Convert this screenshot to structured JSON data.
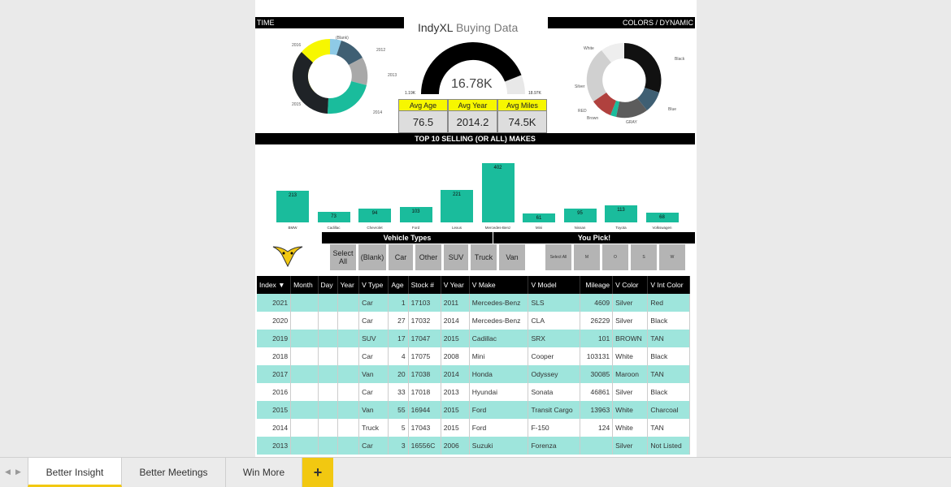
{
  "report": {
    "title_main": "IndyXL",
    "title_sub": "Buying Data",
    "time_header": "TIME",
    "colors_header": "COLORS / DYNAMIC",
    "makes_header": "TOP 10 SELLING (OR ALL) MAKES",
    "vehicle_types_header": "Vehicle Types",
    "you_pick_header": "You Pick!"
  },
  "gauge": {
    "value": "16.78K",
    "min": "1.19K",
    "max": "18.97K",
    "fraction": 0.88
  },
  "kpis": [
    {
      "label": "Avg Age",
      "value": "76.5"
    },
    {
      "label": "Avg Year",
      "value": "2014.2"
    },
    {
      "label": "Avg Miles",
      "value": "74.5K"
    }
  ],
  "time_donut": {
    "labels": [
      "(Blank)",
      "2012",
      "2013",
      "2014",
      "2015",
      "2016"
    ],
    "colors": {
      "blank": "#8ecae6",
      "y2012": "#3f5f73",
      "y2013": "#a9a9a9",
      "y2014": "#1abc9c",
      "y2015": "#1f2327",
      "y2016": "#f7f700"
    }
  },
  "colors_donut": {
    "labels": [
      "Black",
      "Blue",
      "GRAY",
      "Brown",
      "RED",
      "Silver",
      "White"
    ],
    "colors": {
      "black": "#111111",
      "blue": "#3f5f73",
      "gray": "#5c5c5c",
      "brown": "#1abc9c",
      "red": "#b0413e",
      "silver": "#d0d0d0",
      "white": "#eeeeee"
    }
  },
  "chart_data": {
    "type": "bar",
    "title": "TOP 10 SELLING (OR ALL) MAKES",
    "categories": [
      "BMW",
      "Cadillac",
      "Chevrolet",
      "Ford",
      "Lexus",
      "Mercedes-Benz",
      "Mini",
      "Nissan",
      "Toyota",
      "Volkswagen"
    ],
    "values": [
      213,
      73,
      94,
      103,
      221,
      402,
      61,
      95,
      113,
      68
    ],
    "ylim": [
      0,
      402
    ],
    "color": "#1abc9c"
  },
  "vehicle_type_buttons": [
    "Select All",
    "(Blank)",
    "Car",
    "Other",
    "SUV",
    "Truck",
    "Van"
  ],
  "you_pick_buttons": [
    "Select All",
    "M",
    "O",
    "S",
    "W"
  ],
  "table": {
    "columns": [
      "Index",
      "Month",
      "Day",
      "Year",
      "V Type",
      "Age",
      "Stock #",
      "V Year",
      "V Make",
      "V Model",
      "Mileage",
      "V Color",
      "V Int Color"
    ],
    "rows": [
      [
        "2021",
        "",
        "",
        "",
        "Car",
        "1",
        "17103",
        "2011",
        "Mercedes-Benz",
        "SLS",
        "4609",
        "Silver",
        "Red"
      ],
      [
        "2020",
        "",
        "",
        "",
        "Car",
        "27",
        "17032",
        "2014",
        "Mercedes-Benz",
        "CLA",
        "26229",
        "Silver",
        "Black"
      ],
      [
        "2019",
        "",
        "",
        "",
        "SUV",
        "17",
        "17047",
        "2015",
        "Cadillac",
        "SRX",
        "101",
        "BROWN",
        "TAN"
      ],
      [
        "2018",
        "",
        "",
        "",
        "Car",
        "4",
        "17075",
        "2008",
        "Mini",
        "Cooper",
        "103131",
        "White",
        "Black"
      ],
      [
        "2017",
        "",
        "",
        "",
        "Van",
        "20",
        "17038",
        "2014",
        "Honda",
        "Odyssey",
        "30085",
        "Maroon",
        "TAN"
      ],
      [
        "2016",
        "",
        "",
        "",
        "Car",
        "33",
        "17018",
        "2013",
        "Hyundai",
        "Sonata",
        "46861",
        "Silver",
        "Black"
      ],
      [
        "2015",
        "",
        "",
        "",
        "Van",
        "55",
        "16944",
        "2015",
        "Ford",
        "Transit Cargo",
        "13963",
        "White",
        "Charcoal"
      ],
      [
        "2014",
        "",
        "",
        "",
        "Truck",
        "5",
        "17043",
        "2015",
        "Ford",
        "F-150",
        "124",
        "White",
        "TAN"
      ],
      [
        "2013",
        "",
        "",
        "",
        "Car",
        "3",
        "16556C",
        "2006",
        "Suzuki",
        "Forenza",
        "",
        "Silver",
        "Not Listed"
      ]
    ]
  },
  "tabs": [
    "Better Insight",
    "Better Meetings",
    "Win More"
  ],
  "add_tab_label": "+",
  "nav": {
    "prev": "◀",
    "next": "▶"
  }
}
